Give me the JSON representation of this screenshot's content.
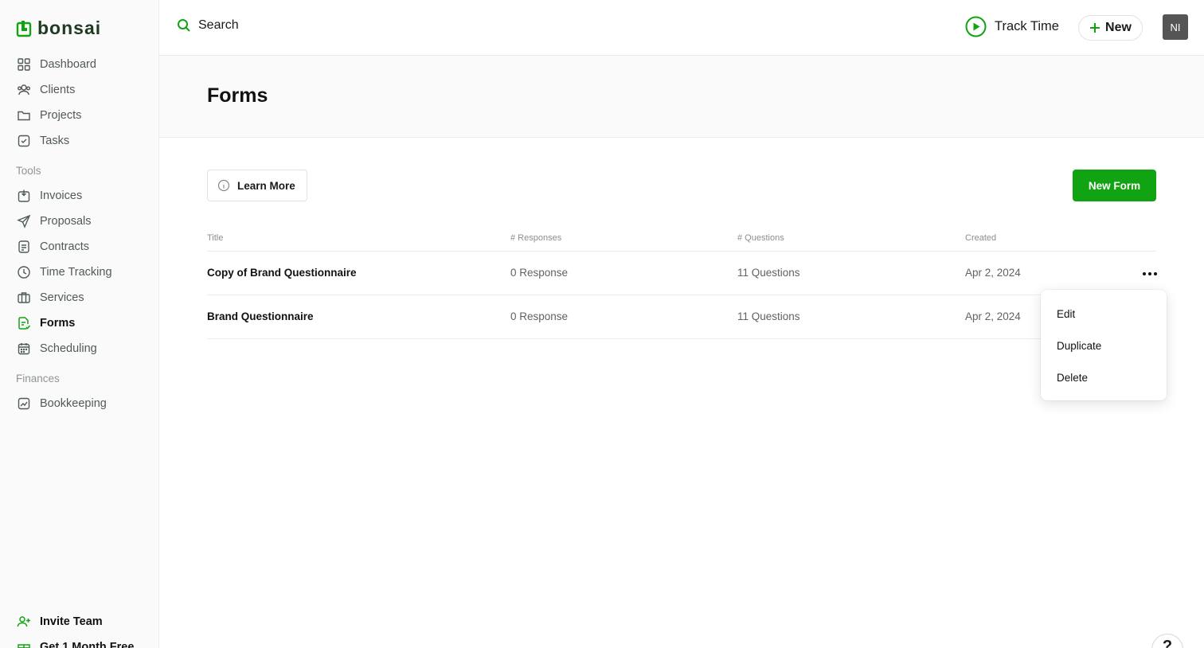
{
  "brand": {
    "name": "bonsai",
    "accent": "#12a312"
  },
  "sidebar": {
    "main_items": [
      {
        "label": "Dashboard",
        "icon": "dashboard-icon"
      },
      {
        "label": "Clients",
        "icon": "clients-icon"
      },
      {
        "label": "Projects",
        "icon": "folder-icon"
      },
      {
        "label": "Tasks",
        "icon": "task-check-icon"
      }
    ],
    "tools_label": "Tools",
    "tools_items": [
      {
        "label": "Invoices",
        "icon": "invoice-icon"
      },
      {
        "label": "Proposals",
        "icon": "send-icon"
      },
      {
        "label": "Contracts",
        "icon": "contract-icon"
      },
      {
        "label": "Time Tracking",
        "icon": "clock-icon"
      },
      {
        "label": "Services",
        "icon": "briefcase-icon"
      },
      {
        "label": "Forms",
        "icon": "forms-icon",
        "active": true
      },
      {
        "label": "Scheduling",
        "icon": "calendar-icon"
      }
    ],
    "finances_label": "Finances",
    "finances_items": [
      {
        "label": "Bookkeeping",
        "icon": "chart-icon"
      }
    ],
    "invite_team": "Invite Team",
    "promo": "Get 1 Month Free"
  },
  "topbar": {
    "search_label": "Search",
    "track_time_label": "Track Time",
    "new_label": "New",
    "avatar_initials": "NI"
  },
  "page": {
    "title": "Forms",
    "learn_more": "Learn More",
    "new_form": "New Form"
  },
  "table": {
    "headers": [
      "Title",
      "# Responses",
      "# Questions",
      "Created"
    ],
    "rows": [
      {
        "title": "Copy of Brand Questionnaire",
        "responses": "0 Response",
        "questions": "11 Questions",
        "created": "Apr 2, 2024"
      },
      {
        "title": "Brand Questionnaire",
        "responses": "0 Response",
        "questions": "11 Questions",
        "created": "Apr 2, 2024"
      }
    ]
  },
  "context_menu": {
    "items": [
      "Edit",
      "Duplicate",
      "Delete"
    ]
  },
  "help_label": "?"
}
